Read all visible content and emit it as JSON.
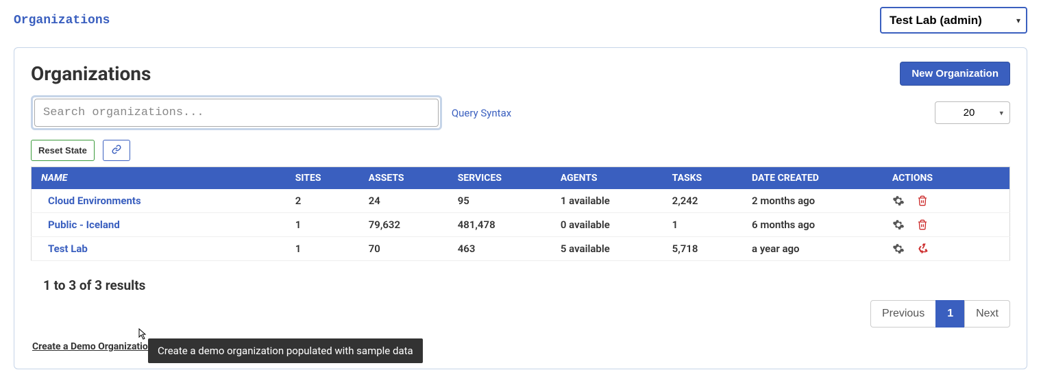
{
  "breadcrumb": "Organizations",
  "org_selector": {
    "selected": "Test Lab (admin)"
  },
  "panel": {
    "title": "Organizations",
    "new_btn": "New Organization",
    "search_placeholder": "Search organizations...",
    "query_syntax": "Query Syntax",
    "page_size": "20",
    "reset_state": "Reset State"
  },
  "table": {
    "headers": {
      "name": "NAME",
      "sites": "SITES",
      "assets": "ASSETS",
      "services": "SERVICES",
      "agents": "AGENTS",
      "tasks": "TASKS",
      "date_created": "DATE CREATED",
      "actions": "ACTIONS"
    },
    "rows": [
      {
        "name": "Cloud Environments",
        "sites": "2",
        "assets": "24",
        "services": "95",
        "agents": "1 available",
        "tasks": "2,242",
        "date_created": "2 months ago",
        "action_icon": "trash"
      },
      {
        "name": "Public - Iceland",
        "sites": "1",
        "assets": "79,632",
        "services": "481,478",
        "agents": "0 available",
        "tasks": "1",
        "date_created": "6 months ago",
        "action_icon": "trash"
      },
      {
        "name": "Test Lab",
        "sites": "1",
        "assets": "70",
        "services": "463",
        "agents": "5 available",
        "tasks": "5,718",
        "date_created": "a year ago",
        "action_icon": "recycle"
      }
    ]
  },
  "results_text": "1 to 3 of 3 results",
  "pagination": {
    "previous": "Previous",
    "page": "1",
    "next": "Next"
  },
  "demo_link": "Create a Demo Organization",
  "tooltip": "Create a demo organization populated with sample data"
}
